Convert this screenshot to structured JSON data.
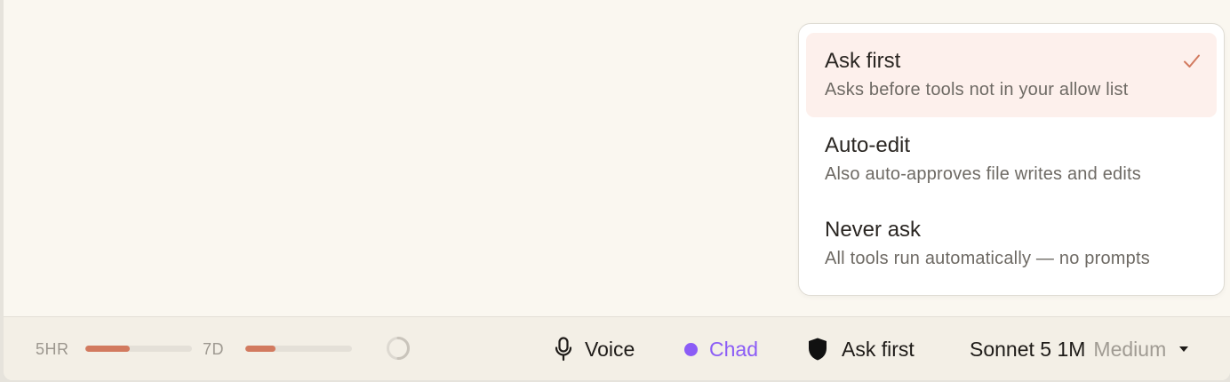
{
  "permission_menu": {
    "options": [
      {
        "title": "Ask first",
        "description": "Asks before tools not in your allow list",
        "selected": true
      },
      {
        "title": "Auto-edit",
        "description": "Also auto-approves file writes and edits",
        "selected": false
      },
      {
        "title": "Never ask",
        "description": "All tools run automatically — no prompts",
        "selected": false
      }
    ]
  },
  "status_bar": {
    "usage_5hr": {
      "label": "5HR",
      "fraction": 0.42
    },
    "usage_7d": {
      "label": "7D",
      "fraction": 0.28
    },
    "voice_label": "Voice",
    "agent_label": "Chad",
    "permission_label": "Ask first",
    "model_name": "Sonnet 5 1M",
    "model_effort": "Medium"
  },
  "colors": {
    "accent": "#d27a5f",
    "agent": "#8b5cf6",
    "selected_bg": "#fdf0ec"
  },
  "icons": {
    "check": "checkmark-icon",
    "voice": "microphone-icon",
    "permission": "shield-icon",
    "model": "caret-down-icon",
    "loading": "spinner-icon"
  }
}
